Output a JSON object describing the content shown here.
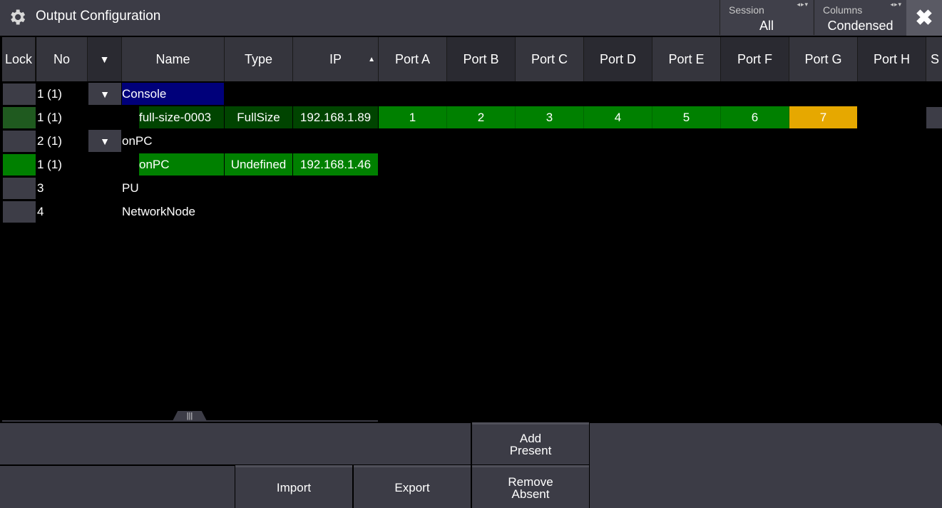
{
  "window": {
    "title": "Output Configuration",
    "icon": "gear-icon"
  },
  "session": {
    "label": "Session",
    "value": "All"
  },
  "columns_selector": {
    "label": "Columns",
    "value": "Condensed"
  },
  "close": {
    "symbol": "✖"
  },
  "headers": {
    "lock": "Lock",
    "no": "No",
    "expand": "▼",
    "name": "Name",
    "type": "Type",
    "ip": "IP",
    "ip_sort": "▲",
    "ports": [
      "Port A",
      "Port B",
      "Port C",
      "Port D",
      "Port E",
      "Port F",
      "Port G",
      "Port H"
    ],
    "overflow": "S"
  },
  "rows": [
    {
      "no": "1 (1)",
      "expander": "▼",
      "name": "Console",
      "type": "",
      "ip": ""
    },
    {
      "no": "1 (1)",
      "expander": "",
      "name": "full-size-0003",
      "type": "FullSize",
      "ip": "192.168.1.89",
      "ports": [
        "1",
        "2",
        "3",
        "4",
        "5",
        "6",
        "7"
      ]
    },
    {
      "no": "2 (1)",
      "expander": "▼",
      "name": "onPC",
      "type": "",
      "ip": ""
    },
    {
      "no": "1 (1)",
      "expander": "",
      "name": "onPC",
      "type": "Undefined",
      "ip": "192.168.1.46"
    },
    {
      "no": "3",
      "expander": "",
      "name": "PU",
      "type": "",
      "ip": ""
    },
    {
      "no": "4",
      "expander": "",
      "name": "NetworkNode",
      "type": "",
      "ip": ""
    }
  ],
  "colors": {
    "green": "#008000",
    "orange": "#e6a800",
    "selection": "#00007a",
    "dark_green": "#004400"
  },
  "divider": {
    "handle_symbol": "|||"
  },
  "buttons": {
    "add_present": "Add\nPresent",
    "remove_absent": "Remove\nAbsent",
    "import": "Import",
    "export": "Export"
  }
}
